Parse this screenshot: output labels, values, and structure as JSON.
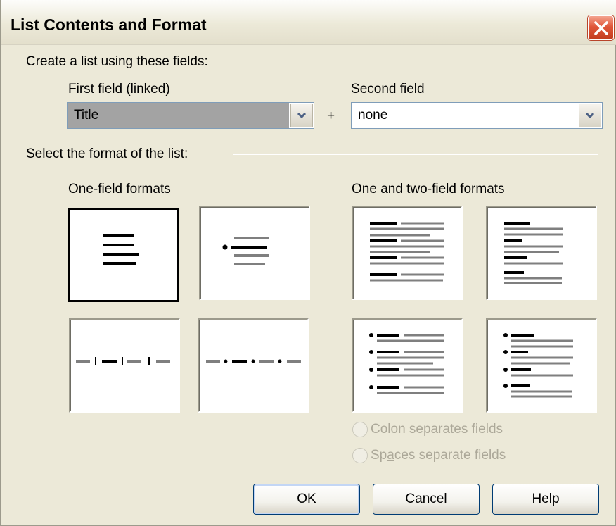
{
  "window": {
    "title": "List Contents and Format",
    "close_icon": "close-icon"
  },
  "fields": {
    "heading": "Create a list using these fields:",
    "first_label_mnemonic": "F",
    "first_label_rest": "irst field (linked)",
    "first_value": "Title",
    "plus": "+",
    "second_label_mnemonic": "S",
    "second_label_rest": "econd field",
    "second_value": "none"
  },
  "format": {
    "heading": "Select the format of the list:",
    "one_field_mnemonic": "O",
    "one_field_rest": "ne-field formats",
    "two_field_prefix": "One and ",
    "two_field_mnemonic": "t",
    "two_field_rest": "wo-field formats",
    "selected_format": "one-field-stacked",
    "tiles": [
      "one-field-stacked",
      "one-field-bulleted",
      "one-field-inline-separated",
      "one-field-inline-bulleted",
      "two-field-columns",
      "two-field-stacked",
      "two-field-bulleted-columns",
      "two-field-bulleted-stacked"
    ]
  },
  "radios": {
    "colon_mnemonic": "C",
    "colon_rest": "olon separates fields",
    "spaces_pre": "Sp",
    "spaces_mnemonic": "a",
    "spaces_rest": "ces separate fields",
    "enabled": false
  },
  "buttons": {
    "ok": "OK",
    "cancel": "Cancel",
    "help": "Help"
  },
  "colors": {
    "dialog_bg": "#ece9d8",
    "close_red": "#e0573a",
    "selected_field_bg": "#a3a3a3",
    "disabled_text": "#aca899"
  }
}
